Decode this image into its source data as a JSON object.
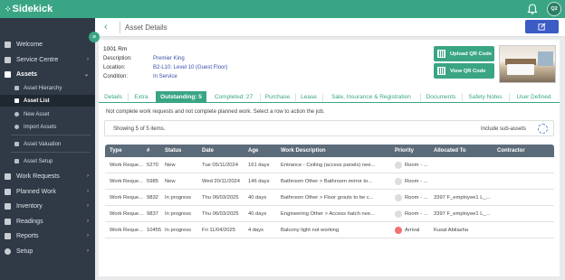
{
  "app": {
    "name": "Sidekick",
    "user_initials": "Q2"
  },
  "colors": {
    "brand": "#3aa585",
    "sidebar": "#2f3a46",
    "edit_button": "#3b5bc5",
    "priority_low": "#dddddd",
    "priority_high": "#f07070"
  },
  "sidebar": {
    "items": [
      {
        "label": "Welcome",
        "icon": "dashboard-icon"
      },
      {
        "label": "Service Centre",
        "icon": "headset-icon"
      },
      {
        "label": "Assets",
        "icon": "assets-icon"
      },
      {
        "label": "Work Requests",
        "icon": "work-requests-icon"
      },
      {
        "label": "Planned Work",
        "icon": "calendar-icon"
      },
      {
        "label": "Inventory",
        "icon": "inventory-icon"
      },
      {
        "label": "Readings",
        "icon": "readings-icon"
      },
      {
        "label": "Reports",
        "icon": "reports-icon"
      },
      {
        "label": "Setup",
        "icon": "gear-icon"
      }
    ],
    "asset_sub": [
      {
        "label": "Asset Hierarchy"
      },
      {
        "label": "Asset List"
      },
      {
        "label": "New Asset"
      },
      {
        "label": "Import Assets"
      },
      {
        "label": "Asset Valuation"
      },
      {
        "label": "Asset Setup"
      }
    ]
  },
  "header": {
    "title": "Asset Details",
    "back_icon": "chevron-left-icon",
    "edit_icon": "edit-icon"
  },
  "asset": {
    "name": "1001 Rm",
    "description_label": "Description:",
    "description": "Premier King",
    "location_label": "Location:",
    "location": "B2-L10: Level 10 (Guest Floor)",
    "condition_label": "Condition:",
    "condition": "In Service"
  },
  "qr": {
    "upload_label": "Upload QR Code",
    "view_label": "View QR Code"
  },
  "tabs": [
    "Details",
    "Extra",
    "Outstanding: 5",
    "Completed: 27",
    "Purchase",
    "Lease",
    "Sale, Insurance & Registration",
    "Documents",
    "Safety Notes",
    "User Defined"
  ],
  "note": "Not complete work requests and not complete planned work. Select a row to action the job.",
  "summary": {
    "showing": "Showing 5 of 5 items.",
    "include_sub_assets": "Include sub-assets"
  },
  "table": {
    "columns": [
      "Type",
      "#",
      "Status",
      "Date",
      "Age",
      "Work Description",
      "Priority",
      "Allocated To",
      "Contractor"
    ],
    "rows": [
      {
        "type": "Work Reque...",
        "num": "5270",
        "status": "New",
        "date": "Tue 05/11/2024",
        "age": "161 days",
        "desc": "Entrance - Ceiling (access panels) nee...",
        "priority": "Room - ...",
        "priority_level": "low",
        "allocated": "",
        "contractor": ""
      },
      {
        "type": "Work Reque...",
        "num": "5985",
        "status": "New",
        "date": "Wed 20/11/2024",
        "age": "146 days",
        "desc": "Bathroom Other > Bathroom mirror to...",
        "priority": "Room - ...",
        "priority_level": "low",
        "allocated": "",
        "contractor": ""
      },
      {
        "type": "Work Reque...",
        "num": "9832",
        "status": "In progress",
        "date": "Thu 06/03/2025",
        "age": "40 days",
        "desc": "Bathroom Other > Floor grouts to be c...",
        "priority": "Room - ...",
        "priority_level": "low",
        "allocated": "3397 F_employee1 L_...",
        "contractor": ""
      },
      {
        "type": "Work Reque...",
        "num": "9837",
        "status": "In progress",
        "date": "Thu 06/03/2025",
        "age": "40 days",
        "desc": "Engineering Other > Access hatch nee...",
        "priority": "Room - ...",
        "priority_level": "low",
        "allocated": "3397 F_employee1 L_...",
        "contractor": ""
      },
      {
        "type": "Work Reque...",
        "num": "10455",
        "status": "In progress",
        "date": "Fri 11/04/2025",
        "age": "4 days",
        "desc": "Balcony light not working",
        "priority": "Arrival",
        "priority_level": "high",
        "allocated": "Kusal Abilasha",
        "contractor": ""
      }
    ]
  }
}
